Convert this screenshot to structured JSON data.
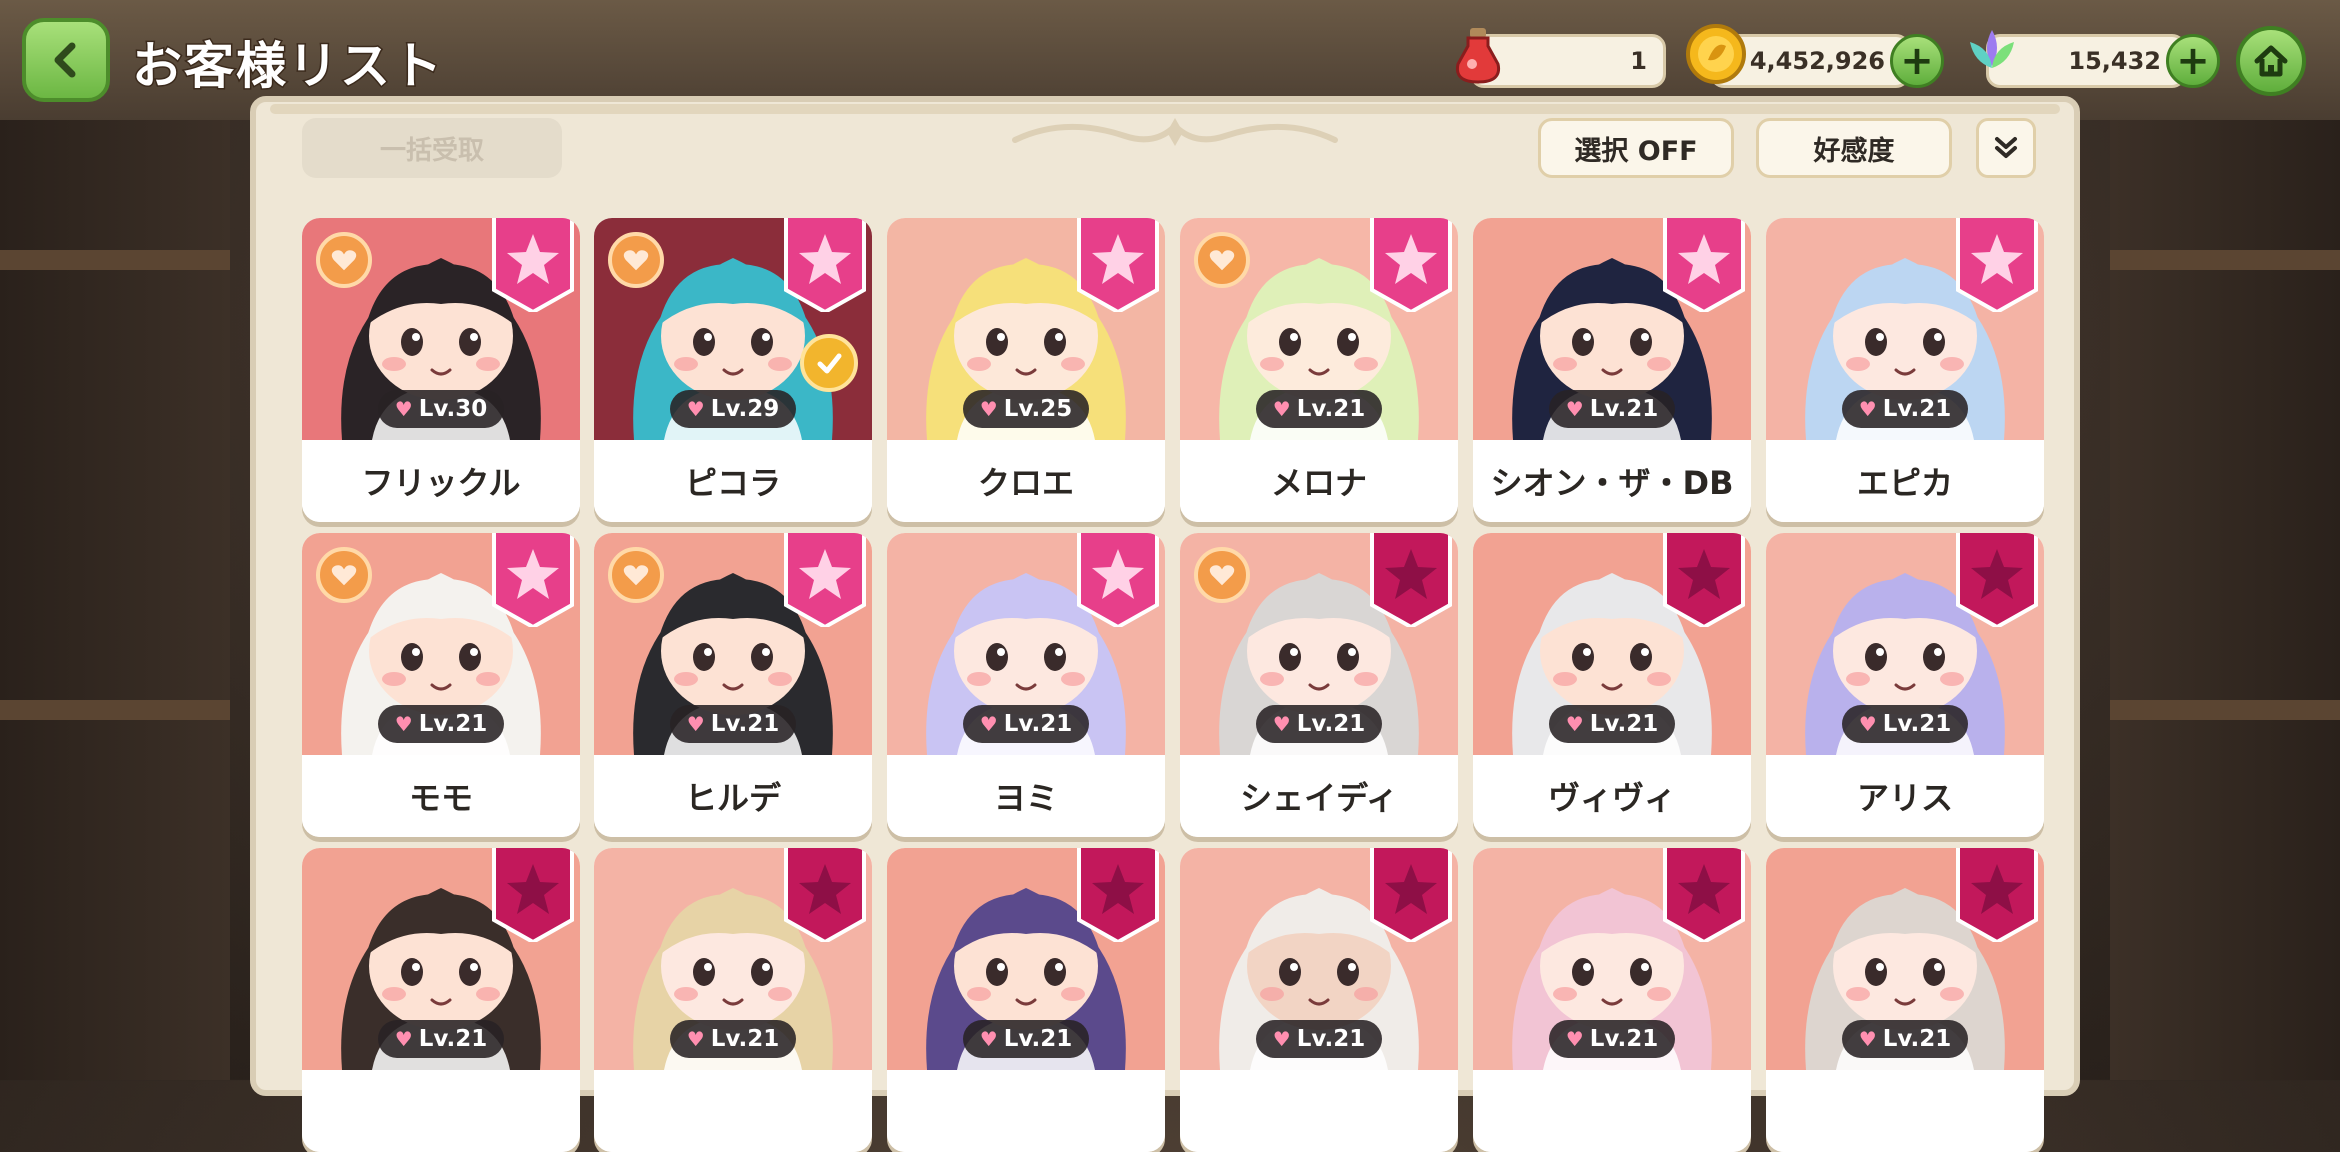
{
  "header": {
    "title": "お客様リスト",
    "resources": [
      {
        "name": "potion",
        "icon": "red-potion-icon",
        "value": "1"
      },
      {
        "name": "gold",
        "icon": "gold-coin-icon",
        "value": "4,452,926"
      },
      {
        "name": "crystal",
        "icon": "leaf-crystal-icon",
        "value": "15,432"
      }
    ]
  },
  "toolbar": {
    "bulk_receive_label": "一括受取",
    "select_label": "選択 OFF",
    "sort_label": "好感度"
  },
  "colors": {
    "accent_green": "#6cb743",
    "ribbon_pink": "#e73f8a",
    "ribbon_dark": "#c2185b",
    "heart_orange": "#f39c4a"
  },
  "customers": [
    {
      "name": "フリックル",
      "level": "Lv.30",
      "star": "bright",
      "heart_badge": true,
      "check_badge": false,
      "bg": "#e8777a",
      "hair": "#2a2326",
      "skin": "#fde2d4"
    },
    {
      "name": "ピコラ",
      "level": "Lv.29",
      "star": "bright",
      "heart_badge": true,
      "check_badge": true,
      "bg": "#8b2d3a",
      "hair": "#3bb7c7",
      "skin": "#fde2d4"
    },
    {
      "name": "クロエ",
      "level": "Lv.25",
      "star": "bright",
      "heart_badge": false,
      "check_badge": false,
      "bg": "#f3b6a4",
      "hair": "#f6e07a",
      "skin": "#fde8d9"
    },
    {
      "name": "メロナ",
      "level": "Lv.21",
      "star": "bright",
      "heart_badge": true,
      "check_badge": false,
      "bg": "#f6b7a8",
      "hair": "#dff0b8",
      "skin": "#fdebdc"
    },
    {
      "name": "シオン・ザ・DB",
      "level": "Lv.21",
      "star": "bright",
      "heart_badge": false,
      "check_badge": false,
      "bg": "#f2a292",
      "hair": "#1f2440",
      "skin": "#fde2d4"
    },
    {
      "name": "エピカ",
      "level": "Lv.21",
      "star": "bright",
      "heart_badge": false,
      "check_badge": false,
      "bg": "#f4b3a5",
      "hair": "#bcd6f2",
      "skin": "#fde8e0"
    },
    {
      "name": "モモ",
      "level": "Lv.21",
      "star": "bright",
      "heart_badge": true,
      "check_badge": false,
      "bg": "#f2a292",
      "hair": "#f4f2ee",
      "skin": "#fde2d4"
    },
    {
      "name": "ヒルデ",
      "level": "Lv.21",
      "star": "bright",
      "heart_badge": true,
      "check_badge": false,
      "bg": "#f2a292",
      "hair": "#2a2a2e",
      "skin": "#fde2d4"
    },
    {
      "name": "ヨミ",
      "level": "Lv.21",
      "star": "bright",
      "heart_badge": false,
      "check_badge": false,
      "bg": "#f4b3a5",
      "hair": "#c9c4f3",
      "skin": "#fde8e0"
    },
    {
      "name": "シェイディ",
      "level": "Lv.21",
      "star": "dark",
      "heart_badge": true,
      "check_badge": false,
      "bg": "#f4b3a5",
      "hair": "#d9d6d4",
      "skin": "#fde8e0"
    },
    {
      "name": "ヴィヴィ",
      "level": "Lv.21",
      "star": "dark",
      "heart_badge": false,
      "check_badge": false,
      "bg": "#f2a292",
      "hair": "#e8e8ea",
      "skin": "#fde2d4"
    },
    {
      "name": "アリス",
      "level": "Lv.21",
      "star": "dark",
      "heart_badge": false,
      "check_badge": false,
      "bg": "#f4b3a5",
      "hair": "#b9b1ec",
      "skin": "#fde8e0"
    },
    {
      "name": "",
      "level": "Lv.21",
      "star": "dark",
      "heart_badge": false,
      "check_badge": false,
      "bg": "#f2a292",
      "hair": "#3a2e2a",
      "skin": "#fde2d4"
    },
    {
      "name": "",
      "level": "Lv.21",
      "star": "dark",
      "heart_badge": false,
      "check_badge": false,
      "bg": "#f4b3a5",
      "hair": "#e7d3a6",
      "skin": "#fde8e0"
    },
    {
      "name": "",
      "level": "Lv.21",
      "star": "dark",
      "heart_badge": false,
      "check_badge": false,
      "bg": "#f2a292",
      "hair": "#5b4a8c",
      "skin": "#fde2d4"
    },
    {
      "name": "",
      "level": "Lv.21",
      "star": "dark",
      "heart_badge": false,
      "check_badge": false,
      "bg": "#f4b3a5",
      "hair": "#f0ece8",
      "skin": "#f2d4c4"
    },
    {
      "name": "",
      "level": "Lv.21",
      "star": "dark",
      "heart_badge": false,
      "check_badge": false,
      "bg": "#f4b3a5",
      "hair": "#f2c4d4",
      "skin": "#fde8e0"
    },
    {
      "name": "",
      "level": "Lv.21",
      "star": "dark",
      "heart_badge": false,
      "check_badge": false,
      "bg": "#f2a292",
      "hair": "#ddd5cf",
      "skin": "#fde8e0"
    }
  ]
}
